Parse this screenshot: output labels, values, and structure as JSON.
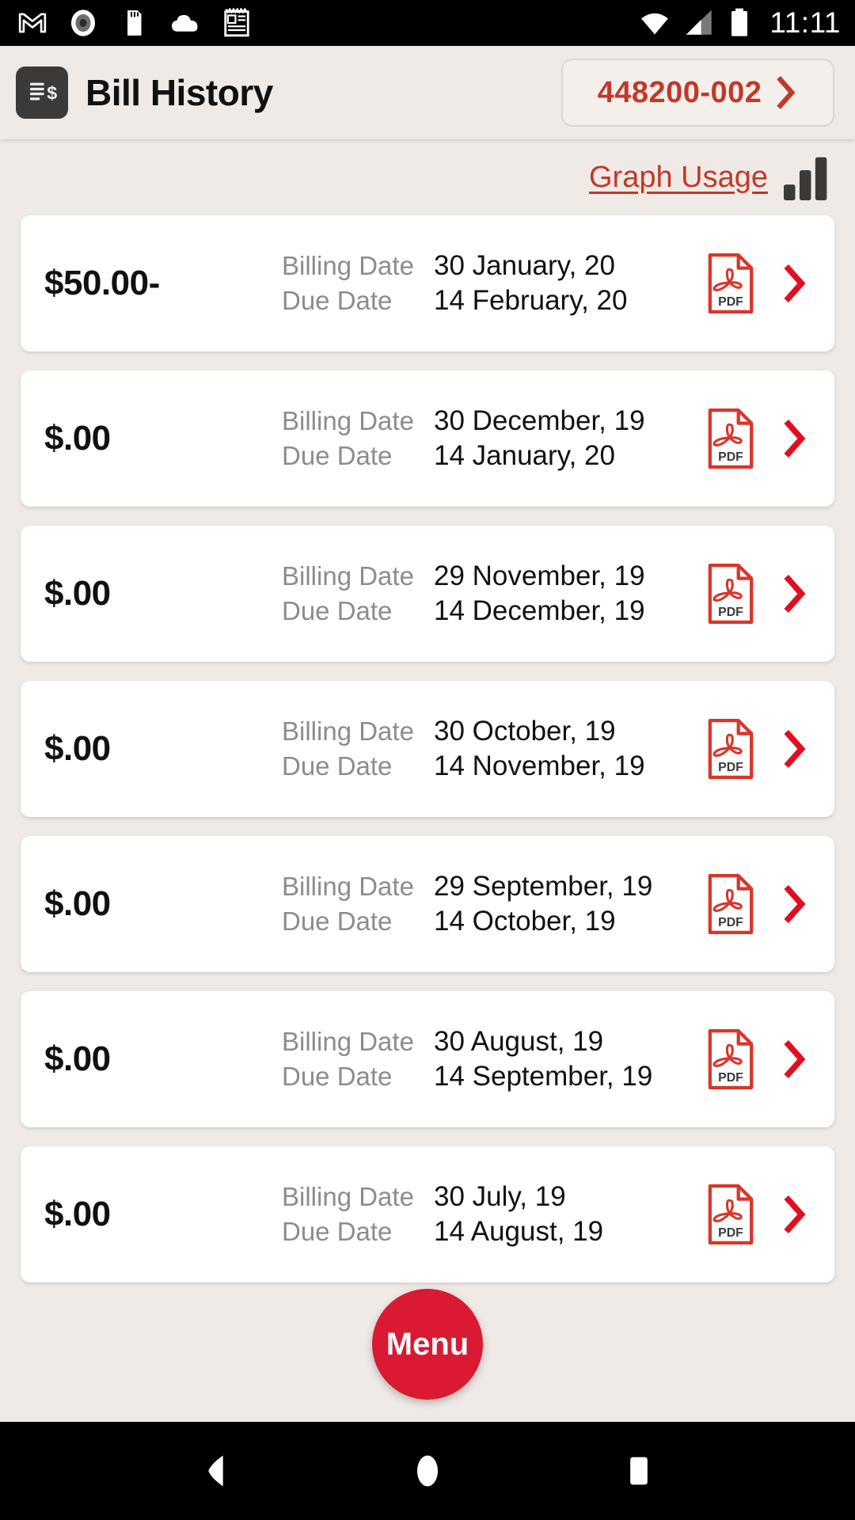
{
  "status_bar": {
    "time": "11:11",
    "left_icons": [
      "gmail-icon",
      "record-circle-icon",
      "sd-card-icon",
      "cloud-icon",
      "notepad-icon"
    ],
    "right_icons": [
      "wifi-icon",
      "cellular-signal-icon",
      "battery-icon"
    ]
  },
  "header": {
    "icon": "bill-document-dollar-icon",
    "title": "Bill History",
    "account_number": "448200-002",
    "account_chevron": "chevron-right-icon"
  },
  "usage": {
    "link_label": "Graph Usage",
    "icon": "bar-chart-icon"
  },
  "colors": {
    "brand_red": "#C0392B",
    "fab_red": "#D91A32",
    "page_bg": "#EFEAE5",
    "card_bg": "#FFFFFF",
    "label_gray": "#8C8C8C",
    "icon_dark": "#3A3A3A"
  },
  "labels": {
    "billing_date": "Billing Date",
    "due_date": "Due Date",
    "pdf": "PDF"
  },
  "bills": [
    {
      "amount": "$50.00-",
      "billing_date": "30 January, 20",
      "due_date": "14 February, 20",
      "pdf_label": "PDF"
    },
    {
      "amount": "$.00",
      "billing_date": "30 December, 19",
      "due_date": "14 January, 20",
      "pdf_label": "PDF"
    },
    {
      "amount": "$.00",
      "billing_date": "29 November, 19",
      "due_date": "14 December, 19",
      "pdf_label": "PDF"
    },
    {
      "amount": "$.00",
      "billing_date": "30 October, 19",
      "due_date": "14 November, 19",
      "pdf_label": "PDF"
    },
    {
      "amount": "$.00",
      "billing_date": "29 September, 19",
      "due_date": "14 October, 19",
      "pdf_label": "PDF"
    },
    {
      "amount": "$.00",
      "billing_date": "30 August, 19",
      "due_date": "14 September, 19",
      "pdf_label": "PDF"
    },
    {
      "amount": "$.00",
      "billing_date": "30 July, 19",
      "due_date": "14 August, 19",
      "pdf_label": "PDF"
    }
  ],
  "fab": {
    "label": "Menu"
  },
  "nav_bar": {
    "back": "back-triangle-icon",
    "home": "home-circle-icon",
    "recents": "recents-square-icon"
  }
}
